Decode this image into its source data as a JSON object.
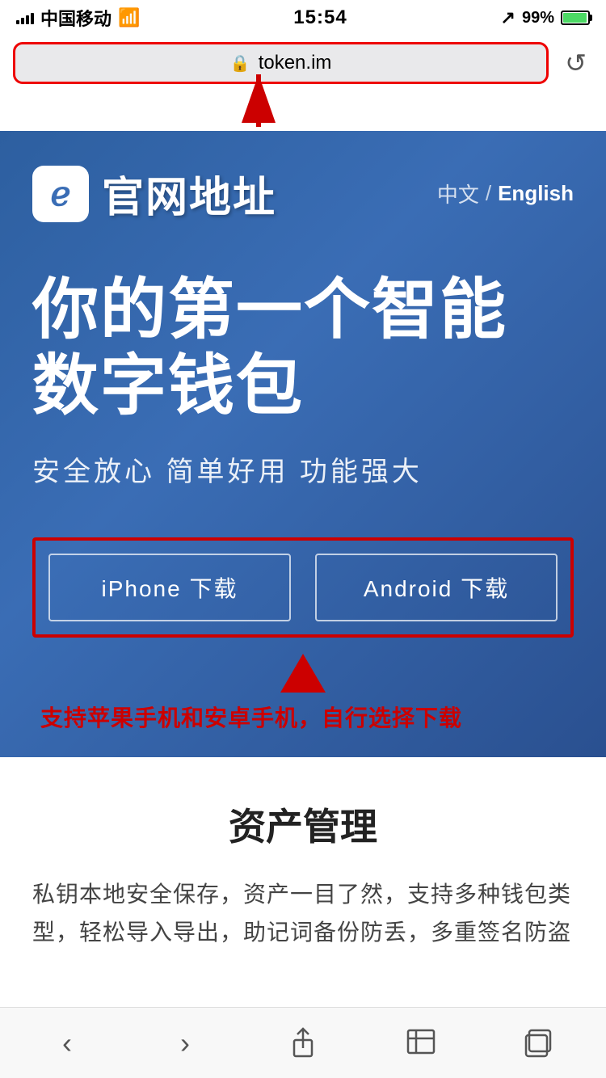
{
  "statusBar": {
    "carrier": "中国移动",
    "wifi": "wifi",
    "time": "15:54",
    "location": "location",
    "battery": "99%"
  },
  "urlBar": {
    "lock": "🔒",
    "url": "token.im",
    "refresh": "↺"
  },
  "header": {
    "logoText": "ℯ",
    "siteName": "官网地址",
    "langChinese": "中文",
    "langDivider": "/",
    "langEnglish": "English"
  },
  "hero": {
    "title": "你的第一个智能数字钱包",
    "subtitle": "安全放心  简单好用  功能强大"
  },
  "downloads": {
    "iphone": "iPhone 下载",
    "android": "Android 下载"
  },
  "annotation": {
    "text": "支持苹果手机和安卓手机，自行选择下载"
  },
  "assetSection": {
    "title": "资产管理",
    "body": "私钥本地安全保存，资产一目了然，支持多种钱包类型，轻松导入导出，助记词备份防丢，多重签名防盗"
  },
  "bottomNav": {
    "back": "‹",
    "forward": "›",
    "share": "share",
    "bookmarks": "bookmarks",
    "tabs": "tabs"
  }
}
